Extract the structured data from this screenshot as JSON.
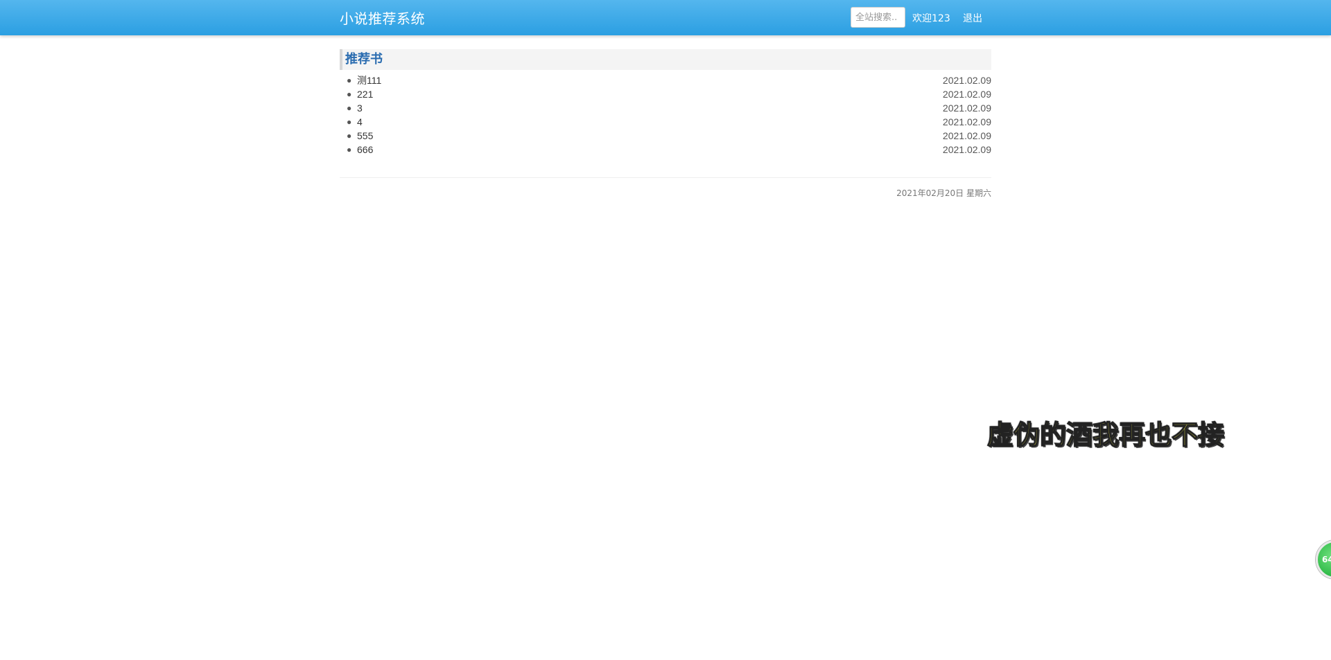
{
  "header": {
    "brand": "小说推荐系统",
    "search": {
      "placeholder": "全站搜索..",
      "value": ""
    },
    "welcome": "欢迎123",
    "logout": "退出"
  },
  "panel": {
    "title": "推荐书",
    "books": [
      {
        "title": "测111",
        "date": "2021.02.09"
      },
      {
        "title": "221",
        "date": "2021.02.09"
      },
      {
        "title": "3",
        "date": "2021.02.09"
      },
      {
        "title": "4",
        "date": "2021.02.09"
      },
      {
        "title": "555",
        "date": "2021.02.09"
      },
      {
        "title": "666",
        "date": "2021.02.09"
      }
    ]
  },
  "footer": {
    "date": "2021年02月20日 星期六"
  },
  "overlay": {
    "lyric": "虚伪的酒我再也不接",
    "badge": "64"
  },
  "colors": {
    "header_top": "#54b6ee",
    "header_bottom": "#2b9fe2",
    "panel_title": "#2a6cb0",
    "lyric": "#f3f04a",
    "badge": "#2cb845"
  }
}
